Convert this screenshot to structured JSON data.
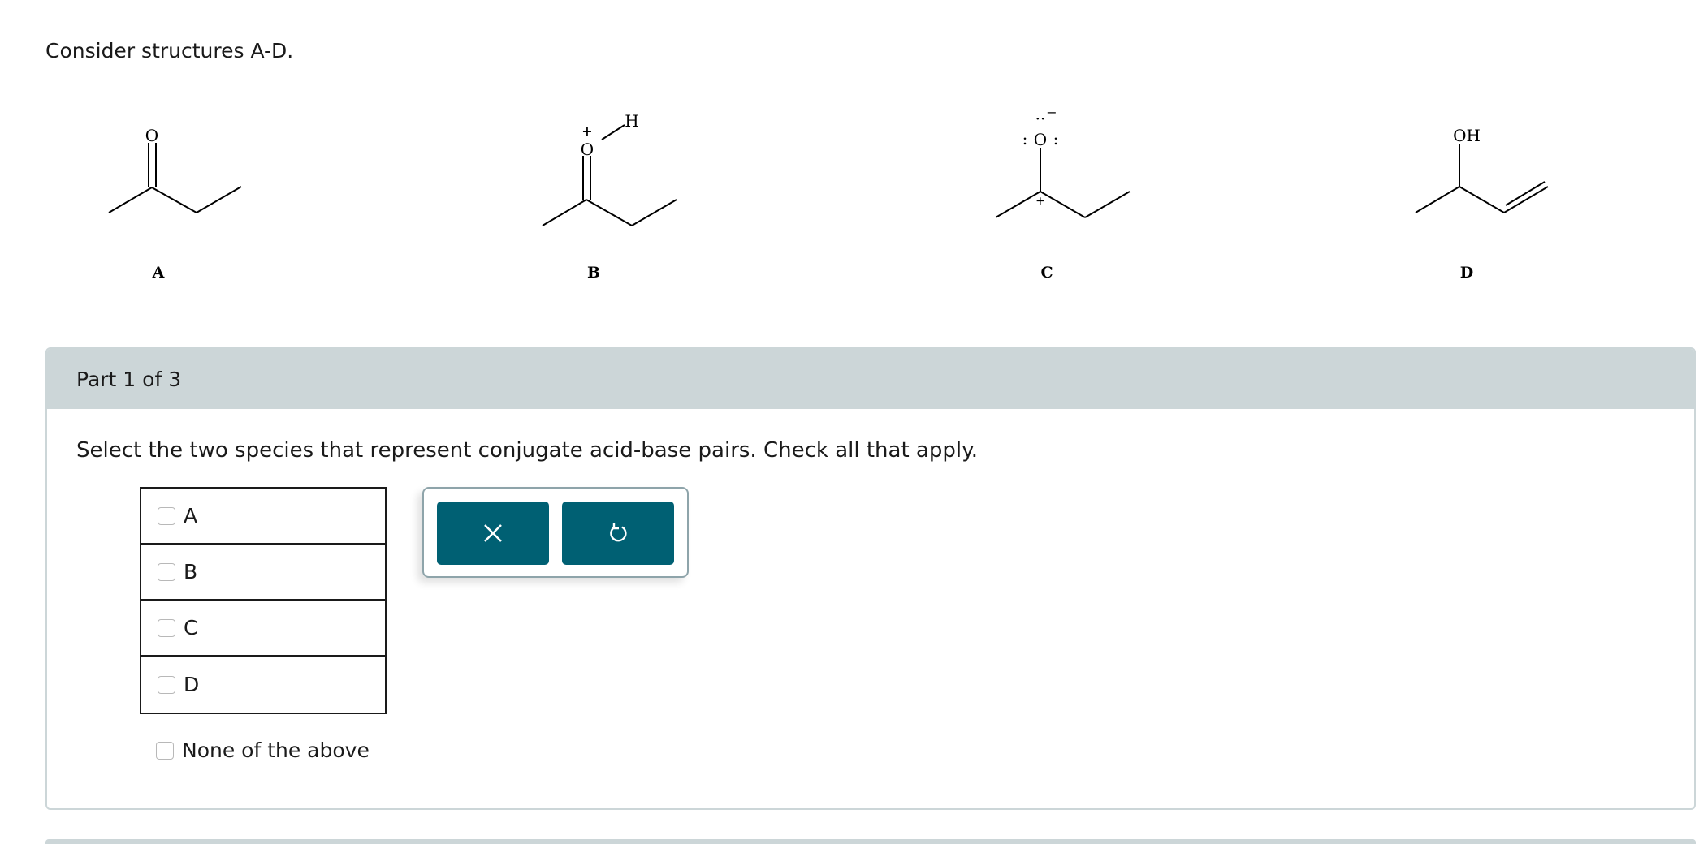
{
  "intro": "Consider structures A-D.",
  "structures": {
    "A": {
      "label": "A",
      "atom": "O"
    },
    "B": {
      "label": "B",
      "atom": "O",
      "charge": "+",
      "h": "H"
    },
    "C": {
      "label": "C",
      "atom": "O",
      "charge_o": "−",
      "charge_c": "+",
      "colon": ":",
      "dots": "··"
    },
    "D": {
      "label": "D",
      "atom": "OH"
    }
  },
  "part": {
    "header": "Part 1 of 3",
    "prompt": "Select the two species that represent conjugate acid-base pairs. Check all that apply.",
    "options": [
      "A",
      "B",
      "C",
      "D"
    ],
    "none_option": "None of the above"
  },
  "tools": {
    "clear_icon": "close-icon",
    "reset_icon": "undo-icon"
  },
  "colors": {
    "accent": "#006073",
    "header_bg": "#ccd6d8"
  }
}
